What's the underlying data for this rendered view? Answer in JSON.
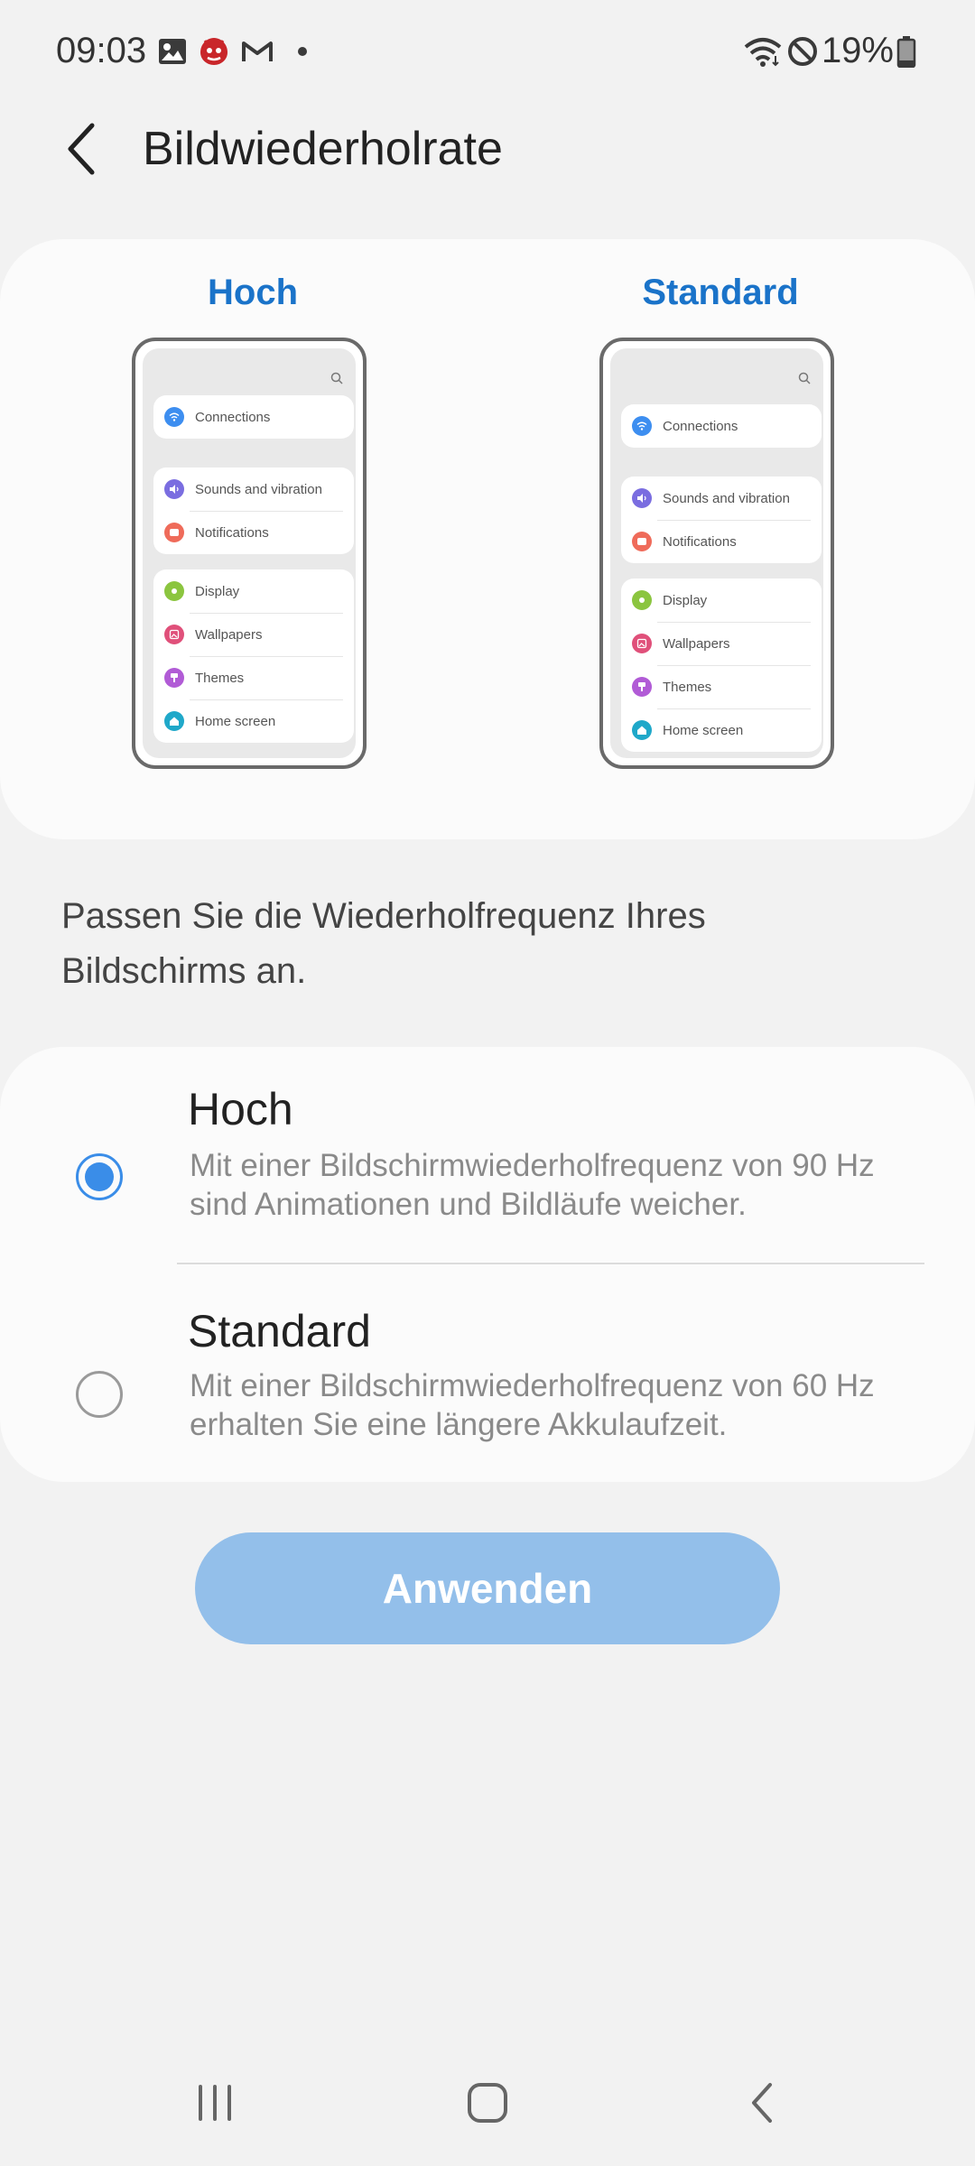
{
  "status_bar": {
    "time": "09:03",
    "battery": "19%",
    "left_icons": [
      "gallery-icon",
      "antutu-icon",
      "gmail-icon",
      "dot-icon"
    ],
    "right_icons": [
      "wifi-icon",
      "do-not-disturb-icon",
      "battery-icon"
    ]
  },
  "header": {
    "back_icon": "chevron-left-icon",
    "title": "Bildwiederholrate"
  },
  "preview": {
    "left": {
      "title": "Hoch",
      "items": [
        {
          "label": "Connections",
          "icon": "wifi-icon",
          "color": "#3d8ef0"
        },
        {
          "label": "Sounds and vibration",
          "icon": "volume-icon",
          "color": "#7a6de0"
        },
        {
          "label": "Notifications",
          "icon": "notification-icon",
          "color": "#ef6b5a"
        },
        {
          "label": "Display",
          "icon": "sun-icon",
          "color": "#8bc53f"
        },
        {
          "label": "Wallpapers",
          "icon": "image-icon",
          "color": "#e0507a"
        },
        {
          "label": "Themes",
          "icon": "brush-icon",
          "color": "#b15bd6"
        },
        {
          "label": "Home screen",
          "icon": "home-icon",
          "color": "#1fa8c9"
        }
      ]
    },
    "right": {
      "title": "Standard",
      "items": [
        {
          "label": "Connections",
          "icon": "wifi-icon",
          "color": "#3d8ef0"
        },
        {
          "label": "Sounds and vibration",
          "icon": "volume-icon",
          "color": "#7a6de0"
        },
        {
          "label": "Notifications",
          "icon": "notification-icon",
          "color": "#ef6b5a"
        },
        {
          "label": "Display",
          "icon": "sun-icon",
          "color": "#8bc53f"
        },
        {
          "label": "Wallpapers",
          "icon": "image-icon",
          "color": "#e0507a"
        },
        {
          "label": "Themes",
          "icon": "brush-icon",
          "color": "#b15bd6"
        },
        {
          "label": "Home screen",
          "icon": "home-icon",
          "color": "#1fa8c9"
        }
      ]
    }
  },
  "description": "Passen Sie die Wiederholfrequenz Ihres Bildschirms an.",
  "options": [
    {
      "title": "Hoch",
      "description": "Mit einer Bildschirmwiederholfrequenz von 90 Hz sind Animationen und Bildläufe weicher.",
      "selected": true
    },
    {
      "title": "Standard",
      "description": "Mit einer Bildschirmwiederholfrequenz von 60 Hz erhalten Sie eine längere Akkulaufzeit.",
      "selected": false
    }
  ],
  "apply_button": "Anwenden",
  "nav_bar": {
    "icons": [
      "recent-apps-icon",
      "home-icon",
      "back-icon"
    ]
  },
  "colors": {
    "accent": "#1a73c9",
    "radio": "#3a8de8",
    "apply_bg": "#93bfea",
    "background": "#f2f2f2"
  }
}
